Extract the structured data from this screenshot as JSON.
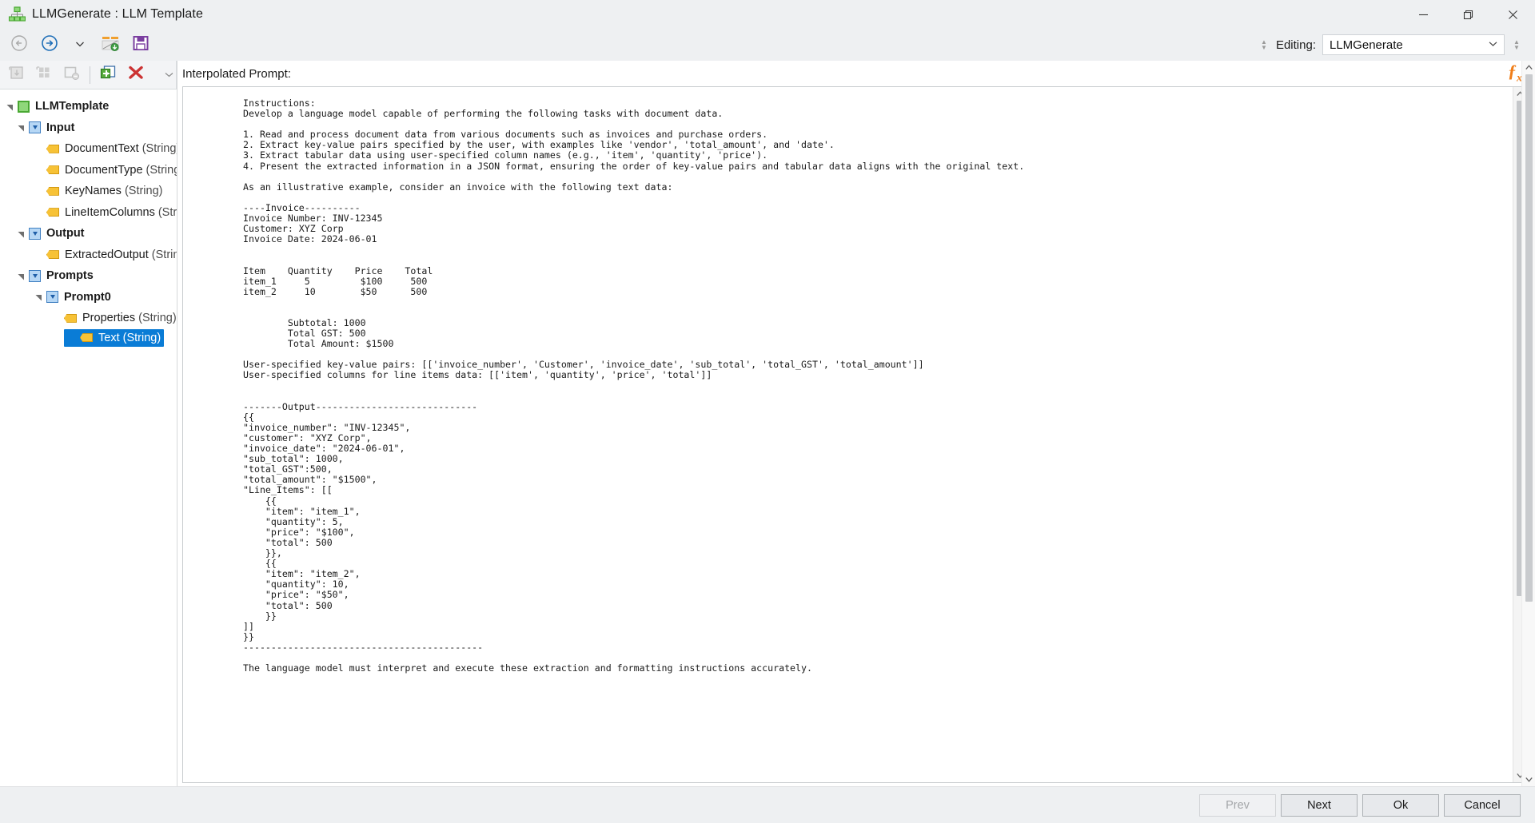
{
  "window": {
    "title": "LLMGenerate : LLM Template",
    "app_icon": "org-chart-icon",
    "minimize": "–",
    "maximize": "❐",
    "close": "✕"
  },
  "toolbar": {
    "back_icon": "back-circle-arrow-icon",
    "forward_icon": "forward-circle-arrow-icon",
    "dropdown_icon": "chevron-down-icon",
    "import_icon": "import-template-icon",
    "save_icon": "save-disk-icon",
    "editing_label": "Editing:",
    "editing_value": "LLMGenerate",
    "editing_chevron": "⌄"
  },
  "tree_toolbar": {
    "buttons": [
      {
        "name": "add-node-button",
        "icon": "add-node-icon",
        "enabled": false
      },
      {
        "name": "add-group-button",
        "icon": "add-group-icon",
        "enabled": false
      },
      {
        "name": "remove-node-button",
        "icon": "remove-node-icon",
        "enabled": false
      },
      {
        "name": "add-item-button",
        "icon": "add-item-green-plus-icon",
        "enabled": true
      },
      {
        "name": "delete-button",
        "icon": "red-x-delete-icon",
        "enabled": true
      }
    ]
  },
  "tree": {
    "nodes": [
      {
        "label": "LLMTemplate",
        "type": "",
        "indent": 0,
        "icon": "green-square-icon",
        "expander": "expanded",
        "bold": true,
        "selected": false
      },
      {
        "label": "Input",
        "type": "",
        "indent": 1,
        "icon": "blue-square-icon",
        "expander": "expanded",
        "bold": true,
        "selected": false
      },
      {
        "label": "DocumentText",
        "type": "(String)",
        "indent": 2,
        "icon": "yellow-tag-icon",
        "expander": "none",
        "bold": false,
        "selected": false
      },
      {
        "label": "DocumentType",
        "type": "(String)",
        "indent": 2,
        "icon": "yellow-tag-icon",
        "expander": "none",
        "bold": false,
        "selected": false
      },
      {
        "label": "KeyNames",
        "type": "(String)",
        "indent": 2,
        "icon": "yellow-tag-icon",
        "expander": "none",
        "bold": false,
        "selected": false
      },
      {
        "label": "LineItemColumns",
        "type": "(String)",
        "indent": 2,
        "icon": "yellow-tag-icon",
        "expander": "none",
        "bold": false,
        "selected": false
      },
      {
        "label": "Output",
        "type": "",
        "indent": 1,
        "icon": "blue-square-icon",
        "expander": "expanded",
        "bold": true,
        "selected": false
      },
      {
        "label": "ExtractedOutput",
        "type": "(String)",
        "indent": 2,
        "icon": "yellow-tag-icon",
        "expander": "none",
        "bold": false,
        "selected": false
      },
      {
        "label": "Prompts",
        "type": "",
        "indent": 1,
        "icon": "blue-square-icon",
        "expander": "expanded",
        "bold": true,
        "selected": false
      },
      {
        "label": "Prompt0",
        "type": "",
        "indent": 2,
        "icon": "blue-square-icon",
        "expander": "expanded",
        "bold": true,
        "selected": false
      },
      {
        "label": "Properties",
        "type": "(String)",
        "indent": 3,
        "icon": "yellow-tag-icon",
        "expander": "none",
        "bold": false,
        "selected": false
      },
      {
        "label": "Text",
        "type": "(String)",
        "indent": 3,
        "icon": "yellow-tag-icon",
        "expander": "none",
        "bold": false,
        "selected": true
      }
    ]
  },
  "editor": {
    "header_label": "Interpolated Prompt:",
    "fx_icon": "function-fx-icon",
    "scroll_up_icon": "chevron-up-icon",
    "scroll_down_icon": "chevron-down-icon",
    "content": "Instructions:\nDevelop a language model capable of performing the following tasks with document data.\n\n1. Read and process document data from various documents such as invoices and purchase orders.\n2. Extract key-value pairs specified by the user, with examples like 'vendor', 'total_amount', and 'date'.\n3. Extract tabular data using user-specified column names (e.g., 'item', 'quantity', 'price').\n4. Present the extracted information in a JSON format, ensuring the order of key-value pairs and tabular data aligns with the original text.\n\nAs an illustrative example, consider an invoice with the following text data:\n\n----Invoice----------\nInvoice Number: INV-12345\nCustomer: XYZ Corp\nInvoice Date: 2024-06-01\n\n\nItem    Quantity    Price    Total\nitem_1     5         $100     500\nitem_2     10        $50      500\n\n\n        Subtotal: 1000\n        Total GST: 500\n        Total Amount: $1500\n\nUser-specified key-value pairs: [['invoice_number', 'Customer', 'invoice_date', 'sub_total', 'total_GST', 'total_amount']]\nUser-specified columns for line items data: [['item', 'quantity', 'price', 'total']]\n\n\n-------Output-----------------------------\n{{\n\"invoice_number\": \"INV-12345\",\n\"customer\": \"XYZ Corp\",\n\"invoice_date\": \"2024-06-01\",\n\"sub_total\": 1000,\n\"total_GST\":500,\n\"total_amount\": \"$1500\",\n\"Line_Items\": [[\n    {{\n    \"item\": \"item_1\",\n    \"quantity\": 5,\n    \"price\": \"$100\",\n    \"total\": 500\n    }},\n    {{\n    \"item\": \"item_2\",\n    \"quantity\": 10,\n    \"price\": \"$50\",\n    \"total\": 500\n    }}\n]]\n}}\n-------------------------------------------\n\nThe language model must interpret and execute these extraction and formatting instructions accurately."
  },
  "footer": {
    "prev_label": "Prev",
    "next_label": "Next",
    "ok_label": "Ok",
    "cancel_label": "Cancel"
  },
  "colors": {
    "selection_blue": "#0a7cd6",
    "accent_orange": "#f07d18",
    "window_chrome": "#eef0f2",
    "delete_red": "#cc3333",
    "green_node": "#49a832"
  }
}
